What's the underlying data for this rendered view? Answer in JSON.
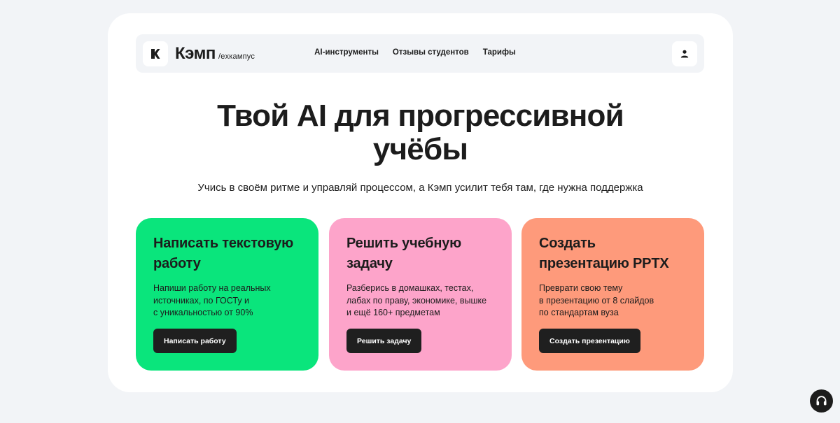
{
  "header": {
    "logo_text": "Кэмп",
    "logo_sub": "/exкампус",
    "nav": [
      "AI-инструменты",
      "Отзывы студентов",
      "Тарифы"
    ]
  },
  "hero": {
    "title_line1": "Твой AI для прогрессивной",
    "title_line2": "учёбы",
    "subtitle": "Учись в своём ритме и управляй процессом, а Кэмп усилит тебя там, где нужна поддержка"
  },
  "tiles": [
    {
      "title": "Написать текстовую работу",
      "desc": "Напиши работу на реальных\nисточниках, по ГОСТу и\nс уникальностью от 90%",
      "button": "Написать работу",
      "color": "#0ae57c"
    },
    {
      "title": "Решить учебную задачу",
      "desc": "Разберись в домашках, тестах,\nлабах по праву, экономике, вышке\nи ещё 160+ предметам",
      "button": "Решить задачу",
      "color": "#fda4ca"
    },
    {
      "title": "Создать презентацию PPTX",
      "desc": "Преврати свою тему\nв презентацию от 8 слайдов\nпо стандартам вуза",
      "button": "Создать презентацию",
      "color": "#fe9a7b"
    }
  ],
  "icons": {
    "logo": "kamp-logo-icon",
    "user": "user-icon",
    "support": "headphones-icon"
  },
  "colors": {
    "page_bg": "#f2f4f7",
    "card_bg": "#ffffff",
    "dark": "#1c1c1c"
  }
}
